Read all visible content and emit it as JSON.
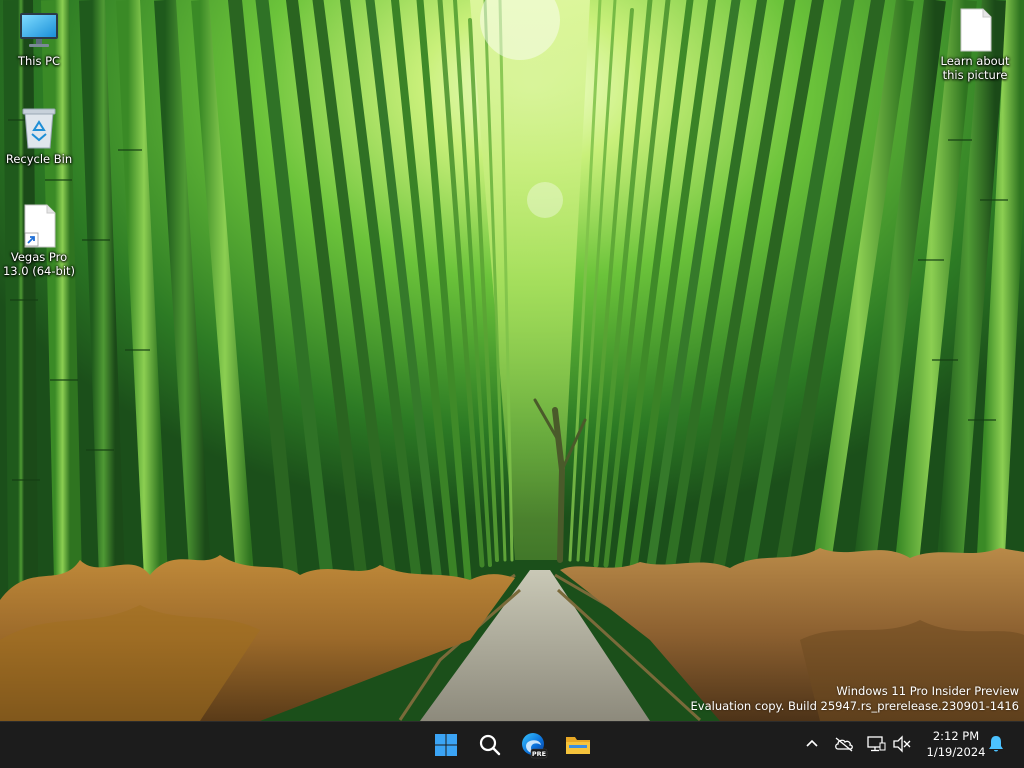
{
  "desktop": {
    "icons": [
      {
        "label": "This PC",
        "icon": "monitor-icon"
      },
      {
        "label": "Recycle Bin",
        "icon": "recycle-bin-icon"
      },
      {
        "label": "Vegas Pro 13.0 (64-bit)",
        "icon": "shortcut-file-icon"
      },
      {
        "label": "Learn about this picture",
        "icon": "file-icon"
      }
    ],
    "wallpaper": "bamboo-forest-path"
  },
  "watermark": {
    "line1": "Windows 11 Pro Insider Preview",
    "line2": "Evaluation copy. Build 25947.rs_prerelease.230901-1416"
  },
  "taskbar": {
    "apps": [
      {
        "name": "Start",
        "icon": "windows-start-icon"
      },
      {
        "name": "Search",
        "icon": "search-icon"
      },
      {
        "name": "Microsoft Edge Preview",
        "icon": "edge-pre-icon",
        "badge": "PRE"
      },
      {
        "name": "File Explorer",
        "icon": "folder-icon"
      }
    ],
    "tray": {
      "icons": [
        "chevron-up-icon",
        "onedrive-offline-icon",
        "network-icon",
        "speaker-muted-icon"
      ],
      "time": "2:12 PM",
      "date": "1/19/2024",
      "notification_icon": "bell-icon"
    }
  },
  "colors": {
    "taskbar_bg": "#1c1c1c",
    "start_blue": "#3ba4f5",
    "folder_yellow": "#f5c33b",
    "bell_blue": "#4cc2ff"
  }
}
